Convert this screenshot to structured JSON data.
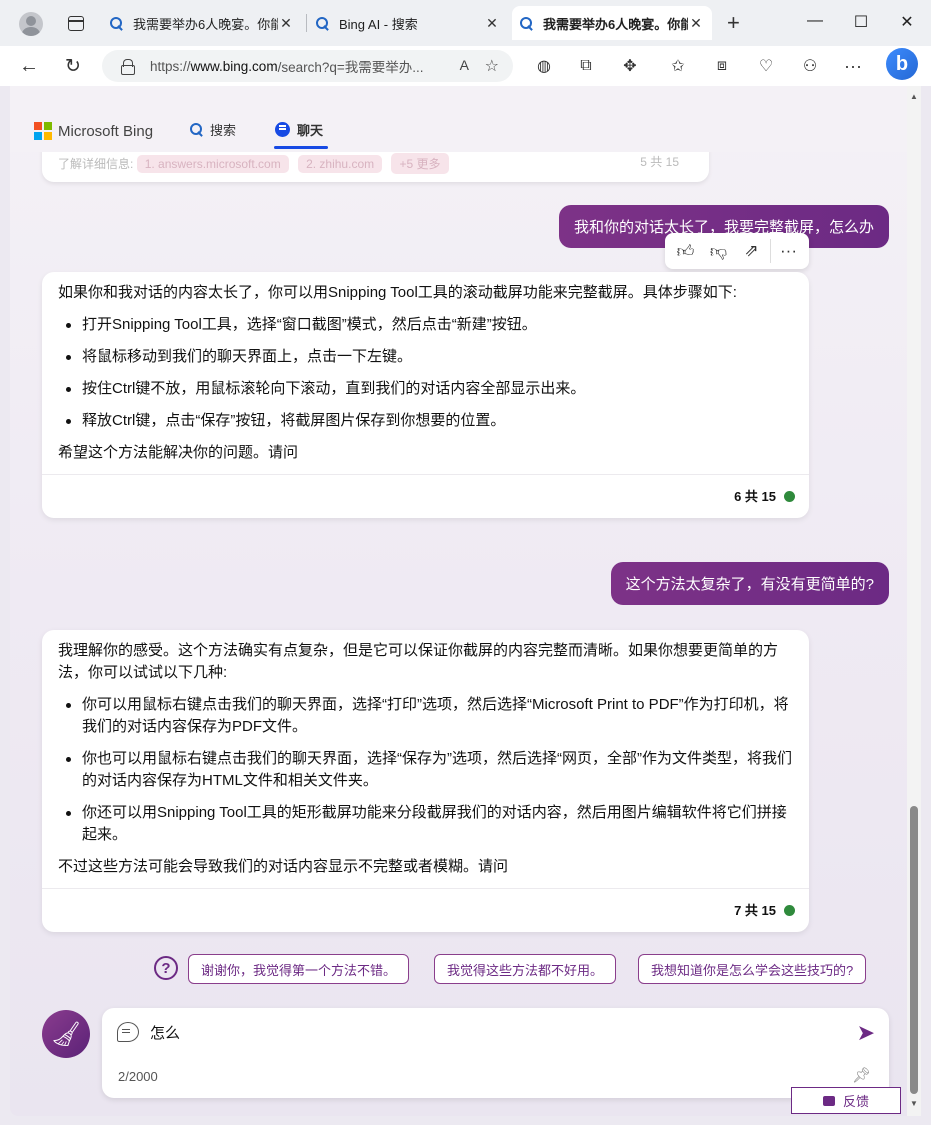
{
  "browser": {
    "tabs": [
      {
        "title": "我需要举办6人晚宴。你能",
        "active": false
      },
      {
        "title": "Bing AI - 搜索",
        "active": false
      },
      {
        "title": "我需要举办6人晚宴。你能",
        "active": true
      }
    ],
    "address": {
      "prefix": "https://",
      "host": "www.bing.com",
      "path": "/search?q=我需要举办..."
    },
    "new_tab": "+",
    "window_controls": {
      "minimize": "—",
      "maximize": "☐",
      "close": "✕"
    }
  },
  "bing": {
    "logo_text": "Microsoft Bing",
    "logo_colors": [
      "#f25022",
      "#7fba00",
      "#00a4ef",
      "#ffb900"
    ],
    "nav": [
      {
        "label": "搜索",
        "active": false
      },
      {
        "label": "聊天",
        "active": true
      }
    ]
  },
  "previous_card": {
    "label": "了解详细信息:",
    "chips": [
      "1. answers.microsoft.com",
      "2. zhihu.com",
      "+5 更多"
    ],
    "counter": "5 共 15"
  },
  "conversation": {
    "user_message_1": "我和你的对话太长了，我要完整截屏，怎么办",
    "reactions": [
      "👍",
      "👎",
      "↗",
      "···"
    ],
    "bot_message_1": {
      "intro": "如果你和我对话的内容太长了，你可以用Snipping Tool工具的滚动截屏功能来完整截屏。具体步骤如下:",
      "steps": [
        "打开Snipping Tool工具，选择“窗口截图”模式，然后点击“新建”按钮。",
        "将鼠标移动到我们的聊天界面上，点击一下左键。",
        "按住Ctrl键不放，用鼠标滚轮向下滚动，直到我们的对话内容全部显示出来。",
        "释放Ctrl键，点击“保存”按钮，将截屏图片保存到你想要的位置。"
      ],
      "outro": "希望这个方法能解决你的问题。请问",
      "counter": "6 共 15"
    },
    "user_message_2": "这个方法太复杂了，有没有更简单的?",
    "bot_message_2": {
      "intro": "我理解你的感受。这个方法确实有点复杂，但是它可以保证你截屏的内容完整而清晰。如果你想要更简单的方法，你可以试试以下几种:",
      "steps": [
        "你可以用鼠标右键点击我们的聊天界面，选择“打印”选项，然后选择“Microsoft Print to PDF”作为打印机，将我们的对话内容保存为PDF文件。",
        "你也可以用鼠标右键点击我们的聊天界面，选择“保存为”选项，然后选择“网页，全部”作为文件类型，将我们的对话内容保存为HTML文件和相关文件夹。",
        "你还可以用Snipping Tool工具的矩形截屏功能来分段截屏我们的对话内容，然后用图片编辑软件将它们拼接起来。"
      ],
      "outro": "不过这些方法可能会导致我们的对话内容显示不完整或者模糊。请问",
      "counter": "7 共 15"
    }
  },
  "suggestions": [
    "谢谢你，我觉得第一个方法不错。",
    "我觉得这些方法都不好用。",
    "我想知道你是怎么学会这些技巧的?"
  ],
  "composer": {
    "value": "怎么",
    "char_count": "2/2000"
  },
  "feedback_label": "反馈",
  "accent_color": "#6c2a84"
}
